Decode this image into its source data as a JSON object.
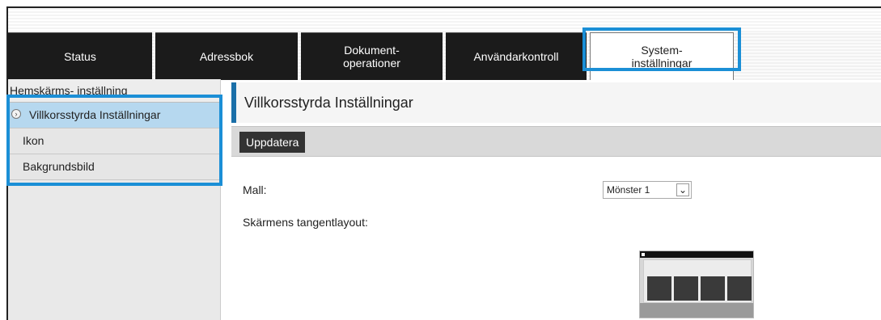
{
  "tabs": [
    {
      "line1": "Status",
      "line2": ""
    },
    {
      "line1": "Adressbok",
      "line2": ""
    },
    {
      "line1": "Dokument-",
      "line2": "operationer"
    },
    {
      "line1": "Användarkontroll",
      "line2": ""
    },
    {
      "line1": "System-",
      "line2": "inställningar"
    }
  ],
  "sidebar": {
    "header": "Hemskärms- inställning",
    "items": [
      {
        "label": "Villkorsstyrda Inställningar"
      },
      {
        "label": "Ikon"
      },
      {
        "label": "Bakgrundsbild"
      }
    ]
  },
  "content": {
    "title": "Villkorsstyrda Inställningar",
    "update_button": "Uppdatera",
    "template_label": "Mall:",
    "template_value": "Mönster 1",
    "layout_label": "Skärmens tangentlayout:"
  },
  "colors": {
    "highlight": "#1b8fd6",
    "tab_dark": "#1b1b1b",
    "selected_item": "#b6d8ef",
    "title_accent": "#1a6fa8"
  },
  "icons": {
    "select_arrow": "chevron-down-icon",
    "selected_marker": "chevron-right-circle-icon"
  }
}
